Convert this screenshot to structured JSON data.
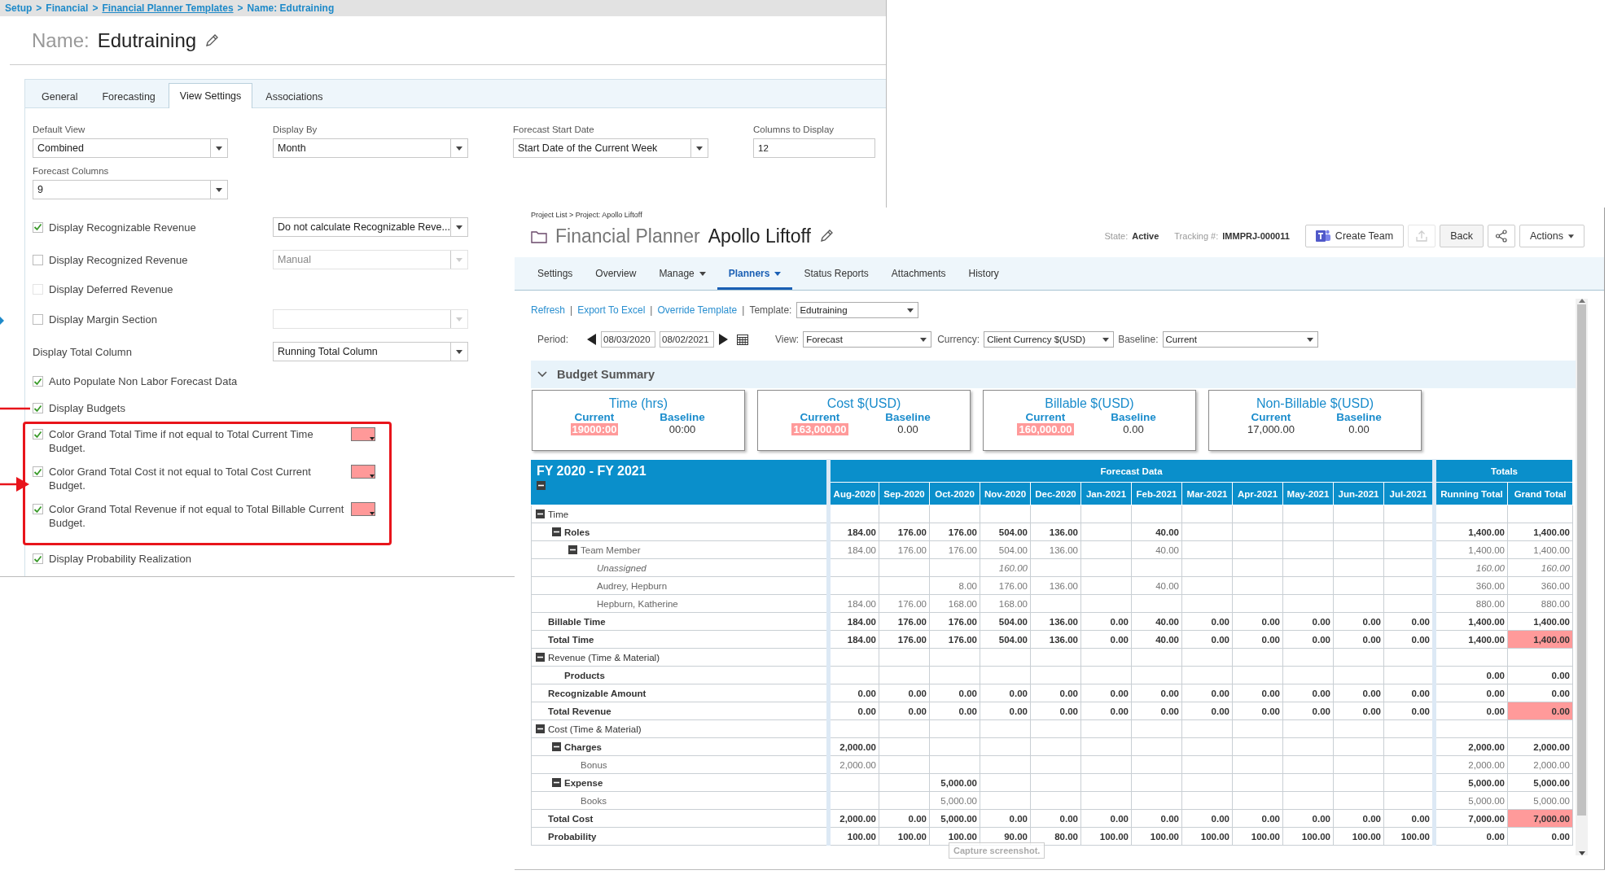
{
  "settings_window": {
    "breadcrumb": {
      "separator": ">",
      "items": [
        {
          "text": "Setup",
          "kind": "text"
        },
        {
          "text": "Financial",
          "kind": "text"
        },
        {
          "text": "Financial Planner Templates",
          "kind": "link"
        },
        {
          "text": "Name: Edutraining",
          "kind": "text"
        }
      ]
    },
    "name_label": "Name:",
    "name": "Edutraining",
    "tabs": [
      {
        "label": "General",
        "selected": false
      },
      {
        "label": "Forecasting",
        "selected": false
      },
      {
        "label": "View Settings",
        "selected": true
      },
      {
        "label": "Associations",
        "selected": false
      }
    ],
    "fields": [
      {
        "label": "Default View",
        "value": "Combined",
        "kind": "select"
      },
      {
        "label": "Display By",
        "value": "Month",
        "kind": "select"
      },
      {
        "label": "Forecast Start Date",
        "value": "Start Date of the Current Week",
        "kind": "select"
      },
      {
        "label": "Columns to Display",
        "value": "12",
        "kind": "text"
      },
      {
        "label": "Forecast Columns",
        "value": "9",
        "kind": "select"
      }
    ],
    "options": [
      {
        "kind": "checkbox",
        "label": "Display Recognizable Revenue",
        "checked": true,
        "disabled": false,
        "select": {
          "value": "Do not calculate Recognizable Reve...",
          "disabled": false
        }
      },
      {
        "kind": "checkbox",
        "label": "Display Recognized Revenue",
        "checked": false,
        "disabled": false,
        "select": {
          "value": "Manual",
          "disabled": true
        }
      },
      {
        "kind": "checkbox",
        "label": "Display Deferred Revenue",
        "checked": false,
        "disabled": true
      },
      {
        "kind": "checkbox",
        "label": "Display Margin Section",
        "checked": false,
        "disabled": false,
        "select": {
          "disabled": true
        }
      },
      {
        "kind": "label",
        "label": "Display Total Column",
        "select": {
          "value": "Running Total Column",
          "disabled": false
        }
      },
      {
        "kind": "checkbox",
        "label": "Auto Populate Non Labor Forecast Data",
        "checked": true,
        "disabled": false
      },
      {
        "kind": "checkbox",
        "label": "Display Budgets",
        "checked": true,
        "disabled": false
      },
      {
        "kind": "color_rule",
        "label": "Color Grand Total Time if not equal to Total Current Time Budget.",
        "checked": true,
        "color": "#ff9999"
      },
      {
        "kind": "color_rule",
        "label": "Color Grand Total Cost it not equal to Total Cost Current Budget.",
        "checked": true,
        "color": "#ff9999"
      },
      {
        "kind": "color_rule",
        "label": "Color Grand Total Revenue if not equal to Total Billable Current Budget.",
        "checked": true,
        "color": "#ff9999"
      },
      {
        "kind": "checkbox",
        "label": "Display Probability Realization",
        "checked": true,
        "disabled": false
      }
    ]
  },
  "planner_window": {
    "breadcrumb": "Project List > Project: Apollo Liftoff",
    "title": "Financial Planner",
    "project": "Apollo Liftoff",
    "state_label": "State:",
    "state": "Active",
    "tracking_label": "Tracking #:",
    "tracking": "IMMPRJ-000011",
    "buttons": [
      {
        "kind": "teams",
        "label": "Create Team",
        "disabled": false
      },
      {
        "kind": "upload",
        "disabled": true
      },
      {
        "kind": "text",
        "label": "Back",
        "disabled": false
      },
      {
        "kind": "share",
        "disabled": false
      },
      {
        "kind": "menu",
        "label": "Actions",
        "disabled": false
      }
    ],
    "tabs": [
      {
        "label": "Settings",
        "selected": false,
        "dropdown": false
      },
      {
        "label": "Overview",
        "selected": false,
        "dropdown": false
      },
      {
        "label": "Manage",
        "selected": false,
        "dropdown": true
      },
      {
        "label": "Planners",
        "selected": true,
        "dropdown": true
      },
      {
        "label": "Status Reports",
        "selected": false,
        "dropdown": false
      },
      {
        "label": "Attachments",
        "selected": false,
        "dropdown": false
      },
      {
        "label": "History",
        "selected": false,
        "dropdown": false
      }
    ],
    "links": [
      "Refresh",
      "Export To Excel",
      "Override Template"
    ],
    "link_separator": "|",
    "template": {
      "label": "Template:",
      "value": "Edutraining"
    },
    "period": {
      "label": "Period:",
      "start": "08/03/2020",
      "end": "08/02/2021"
    },
    "view": {
      "label": "View:",
      "value": "Forecast"
    },
    "currency": {
      "label": "Currency:",
      "value": "Client Currency $(USD)"
    },
    "baseline": {
      "label": "Baseline:",
      "value": "Current"
    },
    "budget_summary": {
      "title": "Budget Summary",
      "expanded": true,
      "cards": [
        {
          "title": "Time (hrs)",
          "current_label": "Current",
          "current": "19000:00",
          "current_flagged": true,
          "baseline_label": "Baseline",
          "baseline": "00:00"
        },
        {
          "title": "Cost $(USD)",
          "current_label": "Current",
          "current": "163,000.00",
          "current_flagged": true,
          "baseline_label": "Baseline",
          "baseline": "0.00"
        },
        {
          "title": "Billable $(USD)",
          "current_label": "Current",
          "current": "160,000.00",
          "current_flagged": true,
          "baseline_label": "Baseline",
          "baseline": "0.00"
        },
        {
          "title": "Non-Billable $(USD)",
          "current_label": "Current",
          "current": "17,000.00",
          "current_flagged": false,
          "baseline_label": "Baseline",
          "baseline": "0.00"
        }
      ]
    },
    "table": {
      "title": "FY 2020 - FY 2021",
      "forecast_group": "Forecast Data",
      "totals_group": "Totals",
      "months": [
        "Aug-2020",
        "Sep-2020",
        "Oct-2020",
        "Nov-2020",
        "Dec-2020",
        "Jan-2021",
        "Feb-2021",
        "Mar-2021",
        "Apr-2021",
        "May-2021",
        "Jun-2021",
        "Jul-2021"
      ],
      "total_columns": [
        "Running Total",
        "Grand Total"
      ],
      "rows": [
        {
          "label": "Time",
          "kind": "group",
          "expanded": true,
          "children": [
            {
              "label": "Roles",
              "kind": "summary",
              "expanded": true,
              "cells": [
                {
                  "kind": "value",
                  "text": "184.00"
                },
                {
                  "kind": "value",
                  "text": "176.00"
                },
                {
                  "kind": "value",
                  "text": "176.00"
                },
                {
                  "kind": "value",
                  "text": "504.00"
                },
                {
                  "kind": "value",
                  "text": "136.00"
                },
                {
                  "kind": "empty"
                },
                {
                  "kind": "value",
                  "text": "40.00"
                },
                {
                  "kind": "empty"
                },
                {
                  "kind": "empty"
                },
                {
                  "kind": "empty"
                },
                {
                  "kind": "empty"
                },
                {
                  "kind": "empty"
                }
              ],
              "running_total": "1,400.00",
              "grand_total": "1,400.00",
              "grand_total_flagged": false,
              "children": [
                {
                  "label": "Team Member",
                  "kind": "detail",
                  "expanded": true,
                  "cells": [
                    {
                      "kind": "value",
                      "text": "184.00"
                    },
                    {
                      "kind": "value",
                      "text": "176.00"
                    },
                    {
                      "kind": "value",
                      "text": "176.00"
                    },
                    {
                      "kind": "value",
                      "text": "504.00"
                    },
                    {
                      "kind": "value",
                      "text": "136.00"
                    },
                    {
                      "kind": "empty"
                    },
                    {
                      "kind": "value",
                      "text": "40.00"
                    },
                    {
                      "kind": "empty"
                    },
                    {
                      "kind": "empty"
                    },
                    {
                      "kind": "empty"
                    },
                    {
                      "kind": "empty"
                    },
                    {
                      "kind": "empty"
                    }
                  ],
                  "running_total": "1,400.00",
                  "grand_total": "1,400.00",
                  "grand_total_flagged": false,
                  "children": [
                    {
                      "label": "Unassigned",
                      "kind": "placeholder",
                      "cells": [
                        {
                          "kind": "empty"
                        },
                        {
                          "kind": "empty"
                        },
                        {
                          "kind": "empty"
                        },
                        {
                          "kind": "value",
                          "text": "160.00"
                        },
                        {
                          "kind": "empty"
                        },
                        {
                          "kind": "empty"
                        },
                        {
                          "kind": "empty"
                        },
                        {
                          "kind": "empty"
                        },
                        {
                          "kind": "empty"
                        },
                        {
                          "kind": "empty"
                        },
                        {
                          "kind": "empty"
                        },
                        {
                          "kind": "empty"
                        }
                      ],
                      "running_total": "160.00",
                      "grand_total": "160.00",
                      "grand_total_flagged": false
                    },
                    {
                      "label": "Audrey, Hepburn",
                      "kind": "detail",
                      "cells": [
                        {
                          "kind": "empty"
                        },
                        {
                          "kind": "empty"
                        },
                        {
                          "kind": "value",
                          "text": "8.00"
                        },
                        {
                          "kind": "value",
                          "text": "176.00"
                        },
                        {
                          "kind": "value",
                          "text": "136.00"
                        },
                        {
                          "kind": "empty"
                        },
                        {
                          "kind": "value",
                          "text": "40.00"
                        },
                        {
                          "kind": "empty"
                        },
                        {
                          "kind": "empty"
                        },
                        {
                          "kind": "empty"
                        },
                        {
                          "kind": "empty"
                        },
                        {
                          "kind": "empty"
                        }
                      ],
                      "running_total": "360.00",
                      "grand_total": "360.00",
                      "grand_total_flagged": false
                    },
                    {
                      "label": "Hepburn, Katherine",
                      "kind": "detail",
                      "cells": [
                        {
                          "kind": "value",
                          "text": "184.00"
                        },
                        {
                          "kind": "value",
                          "text": "176.00"
                        },
                        {
                          "kind": "value",
                          "text": "168.00"
                        },
                        {
                          "kind": "value",
                          "text": "168.00"
                        },
                        {
                          "kind": "empty"
                        },
                        {
                          "kind": "empty"
                        },
                        {
                          "kind": "empty"
                        },
                        {
                          "kind": "empty"
                        },
                        {
                          "kind": "empty"
                        },
                        {
                          "kind": "empty"
                        },
                        {
                          "kind": "empty"
                        },
                        {
                          "kind": "empty"
                        }
                      ],
                      "running_total": "880.00",
                      "grand_total": "880.00",
                      "grand_total_flagged": false
                    }
                  ]
                }
              ]
            }
          ]
        },
        {
          "label": "Billable Time",
          "kind": "summary",
          "cells": [
            {
              "kind": "value",
              "text": "184.00"
            },
            {
              "kind": "value",
              "text": "176.00"
            },
            {
              "kind": "value",
              "text": "176.00"
            },
            {
              "kind": "value",
              "text": "504.00"
            },
            {
              "kind": "value",
              "text": "136.00"
            },
            {
              "kind": "value",
              "text": "0.00"
            },
            {
              "kind": "value",
              "text": "40.00"
            },
            {
              "kind": "value",
              "text": "0.00"
            },
            {
              "kind": "value",
              "text": "0.00"
            },
            {
              "kind": "value",
              "text": "0.00"
            },
            {
              "kind": "value",
              "text": "0.00"
            },
            {
              "kind": "value",
              "text": "0.00"
            }
          ],
          "running_total": "1,400.00",
          "grand_total": "1,400.00",
          "grand_total_flagged": false
        },
        {
          "label": "Total Time",
          "kind": "summary",
          "cells": [
            {
              "kind": "value",
              "text": "184.00"
            },
            {
              "kind": "value",
              "text": "176.00"
            },
            {
              "kind": "value",
              "text": "176.00"
            },
            {
              "kind": "value",
              "text": "504.00"
            },
            {
              "kind": "value",
              "text": "136.00"
            },
            {
              "kind": "value",
              "text": "0.00"
            },
            {
              "kind": "value",
              "text": "40.00"
            },
            {
              "kind": "value",
              "text": "0.00"
            },
            {
              "kind": "value",
              "text": "0.00"
            },
            {
              "kind": "value",
              "text": "0.00"
            },
            {
              "kind": "value",
              "text": "0.00"
            },
            {
              "kind": "value",
              "text": "0.00"
            }
          ],
          "running_total": "1,400.00",
          "grand_total": "1,400.00",
          "grand_total_flagged": true
        },
        {
          "label": "Revenue (Time & Material)",
          "kind": "group",
          "expanded": true,
          "children": [
            {
              "label": "Products",
              "kind": "summary",
              "running_total": "0.00",
              "grand_total": "0.00",
              "grand_total_flagged": false
            }
          ]
        },
        {
          "label": "Recognizable Amount",
          "kind": "summary",
          "cells": [
            {
              "kind": "value",
              "text": "0.00"
            },
            {
              "kind": "value",
              "text": "0.00"
            },
            {
              "kind": "value",
              "text": "0.00"
            },
            {
              "kind": "value",
              "text": "0.00"
            },
            {
              "kind": "value",
              "text": "0.00"
            },
            {
              "kind": "value",
              "text": "0.00"
            },
            {
              "kind": "value",
              "text": "0.00"
            },
            {
              "kind": "value",
              "text": "0.00"
            },
            {
              "kind": "value",
              "text": "0.00"
            },
            {
              "kind": "value",
              "text": "0.00"
            },
            {
              "kind": "value",
              "text": "0.00"
            },
            {
              "kind": "value",
              "text": "0.00"
            }
          ],
          "running_total": "0.00",
          "grand_total": "0.00",
          "grand_total_flagged": false
        },
        {
          "label": "Total Revenue",
          "kind": "summary",
          "cells": [
            {
              "kind": "value",
              "text": "0.00"
            },
            {
              "kind": "value",
              "text": "0.00"
            },
            {
              "kind": "value",
              "text": "0.00"
            },
            {
              "kind": "value",
              "text": "0.00"
            },
            {
              "kind": "value",
              "text": "0.00"
            },
            {
              "kind": "value",
              "text": "0.00"
            },
            {
              "kind": "value",
              "text": "0.00"
            },
            {
              "kind": "value",
              "text": "0.00"
            },
            {
              "kind": "value",
              "text": "0.00"
            },
            {
              "kind": "value",
              "text": "0.00"
            },
            {
              "kind": "value",
              "text": "0.00"
            },
            {
              "kind": "value",
              "text": "0.00"
            }
          ],
          "running_total": "0.00",
          "grand_total": "0.00",
          "grand_total_flagged": true
        },
        {
          "label": "Cost (Time & Material)",
          "kind": "group",
          "expanded": true,
          "children": [
            {
              "label": "Charges",
              "kind": "summary",
              "expanded": true,
              "cells": [
                {
                  "kind": "value",
                  "text": "2,000.00"
                },
                {
                  "kind": "empty"
                },
                {
                  "kind": "empty"
                },
                {
                  "kind": "empty"
                },
                {
                  "kind": "empty"
                },
                {
                  "kind": "empty"
                },
                {
                  "kind": "empty"
                },
                {
                  "kind": "empty"
                },
                {
                  "kind": "empty"
                },
                {
                  "kind": "empty"
                },
                {
                  "kind": "empty"
                },
                {
                  "kind": "empty"
                }
              ],
              "running_total": "2,000.00",
              "grand_total": "2,000.00",
              "grand_total_flagged": false,
              "children": [
                {
                  "label": "Bonus",
                  "kind": "detail",
                  "cells": [
                    {
                      "kind": "value",
                      "text": "2,000.00"
                    },
                    {
                      "kind": "empty"
                    },
                    {
                      "kind": "empty"
                    },
                    {
                      "kind": "empty"
                    },
                    {
                      "kind": "empty"
                    },
                    {
                      "kind": "empty"
                    },
                    {
                      "kind": "empty"
                    },
                    {
                      "kind": "empty"
                    },
                    {
                      "kind": "empty"
                    },
                    {
                      "kind": "empty"
                    },
                    {
                      "kind": "empty"
                    },
                    {
                      "kind": "empty"
                    }
                  ],
                  "running_total": "2,000.00",
                  "grand_total": "2,000.00",
                  "grand_total_flagged": false
                }
              ]
            },
            {
              "label": "Expense",
              "kind": "summary",
              "expanded": true,
              "cells": [
                {
                  "kind": "empty"
                },
                {
                  "kind": "empty"
                },
                {
                  "kind": "value",
                  "text": "5,000.00"
                },
                {
                  "kind": "empty"
                },
                {
                  "kind": "empty"
                },
                {
                  "kind": "empty"
                },
                {
                  "kind": "empty"
                },
                {
                  "kind": "empty"
                },
                {
                  "kind": "empty"
                },
                {
                  "kind": "empty"
                },
                {
                  "kind": "empty"
                },
                {
                  "kind": "empty"
                }
              ],
              "running_total": "5,000.00",
              "grand_total": "5,000.00",
              "grand_total_flagged": false,
              "children": [
                {
                  "label": "Books",
                  "kind": "detail",
                  "cells": [
                    {
                      "kind": "empty"
                    },
                    {
                      "kind": "empty"
                    },
                    {
                      "kind": "value",
                      "text": "5,000.00"
                    },
                    {
                      "kind": "empty"
                    },
                    {
                      "kind": "empty"
                    },
                    {
                      "kind": "empty"
                    },
                    {
                      "kind": "empty"
                    },
                    {
                      "kind": "empty"
                    },
                    {
                      "kind": "empty"
                    },
                    {
                      "kind": "empty"
                    },
                    {
                      "kind": "empty"
                    },
                    {
                      "kind": "empty"
                    }
                  ],
                  "running_total": "5,000.00",
                  "grand_total": "5,000.00",
                  "grand_total_flagged": false
                }
              ]
            }
          ]
        },
        {
          "label": "Total Cost",
          "kind": "summary",
          "cells": [
            {
              "kind": "value",
              "text": "2,000.00"
            },
            {
              "kind": "value",
              "text": "0.00"
            },
            {
              "kind": "value",
              "text": "5,000.00"
            },
            {
              "kind": "value",
              "text": "0.00"
            },
            {
              "kind": "value",
              "text": "0.00"
            },
            {
              "kind": "value",
              "text": "0.00"
            },
            {
              "kind": "value",
              "text": "0.00"
            },
            {
              "kind": "value",
              "text": "0.00"
            },
            {
              "kind": "value",
              "text": "0.00"
            },
            {
              "kind": "value",
              "text": "0.00"
            },
            {
              "kind": "value",
              "text": "0.00"
            },
            {
              "kind": "value",
              "text": "0.00"
            }
          ],
          "running_total": "7,000.00",
          "grand_total": "7,000.00",
          "grand_total_flagged": true
        },
        {
          "label": "Probability",
          "kind": "summary",
          "cells": [
            {
              "kind": "value",
              "text": "100.00"
            },
            {
              "kind": "value",
              "text": "100.00"
            },
            {
              "kind": "value",
              "text": "100.00"
            },
            {
              "kind": "value",
              "text": "90.00"
            },
            {
              "kind": "value",
              "text": "80.00"
            },
            {
              "kind": "value",
              "text": "100.00"
            },
            {
              "kind": "value",
              "text": "100.00"
            },
            {
              "kind": "value",
              "text": "100.00"
            },
            {
              "kind": "value",
              "text": "100.00"
            },
            {
              "kind": "value",
              "text": "100.00"
            },
            {
              "kind": "value",
              "text": "100.00"
            },
            {
              "kind": "value",
              "text": "100.00"
            }
          ],
          "running_total": "0.00",
          "grand_total": "0.00",
          "grand_total_flagged": false
        }
      ]
    }
  },
  "tooltip": "Capture screenshot."
}
